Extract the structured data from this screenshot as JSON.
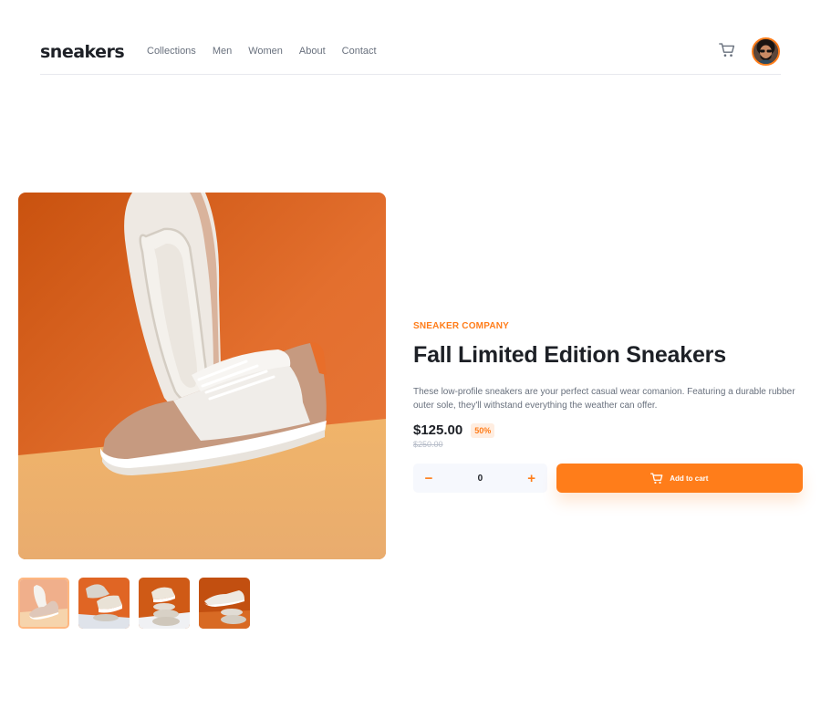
{
  "header": {
    "logo": "sneakers",
    "nav": [
      "Collections",
      "Men",
      "Women",
      "About",
      "Contact"
    ],
    "cart_icon": "cart-icon",
    "avatar_icon": "avatar"
  },
  "gallery": {
    "main_image": "sneaker-product-photo",
    "thumbnail_count": 4,
    "active_thumbnail": 1
  },
  "product": {
    "company": "SNEAKER COMPANY",
    "title": "Fall Limited Edition Sneakers",
    "description": "These low-profile sneakers are your perfect casual wear comanion. Featuring a durable rubber outer sole, they'll withstand everything the weather can offer.",
    "price": "$125.00",
    "discount": "50%",
    "original_price": "$250.00"
  },
  "cart_controls": {
    "decrement": "−",
    "quantity": "0",
    "increment": "+",
    "add_label": "Add to cart"
  },
  "colors": {
    "accent": "#ff7d1a",
    "accent_pale": "#ffede0",
    "dark": "#1d2026",
    "gray": "#68707d",
    "light_gray": "#b6bcc8",
    "qty_bg": "#f6f8fd"
  }
}
